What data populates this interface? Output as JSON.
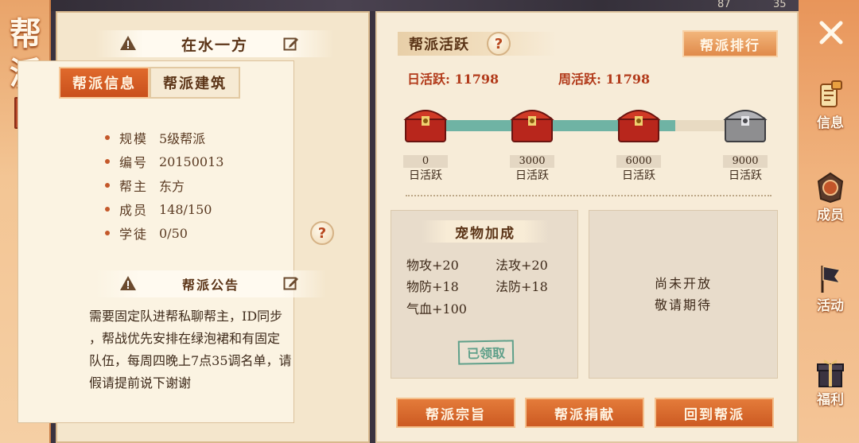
{
  "top_strip": {
    "left_number": "87",
    "right_number": "35"
  },
  "banner": {
    "title": "帮派"
  },
  "guild_name": "在水一方",
  "tabs": [
    {
      "label": "帮派信息",
      "active": true
    },
    {
      "label": "帮派建筑",
      "active": false
    }
  ],
  "info": [
    {
      "key": "规模",
      "value": "5级帮派"
    },
    {
      "key": "编号",
      "value": "20150013"
    },
    {
      "key": "帮主",
      "value": "东方"
    },
    {
      "key": "成员",
      "value": "148/150"
    },
    {
      "key": "学徒",
      "value": "0/50"
    }
  ],
  "help_glyph": "?",
  "notice": {
    "title": "帮派公告",
    "lines": [
      "需要固定队进帮私聊帮主，ID同步",
      "，帮战优先安排在绿泡裙和有固定",
      "队伍，每周四晚上7点35调名单，请",
      "假请提前说下谢谢"
    ]
  },
  "activity": {
    "title": "帮派活跃",
    "rank_button": "帮派排行",
    "daily_label": "日活跃: 11798",
    "weekly_label": "周活跃: 11798",
    "progress_fraction": 0.78,
    "chests": [
      {
        "value": "0",
        "label": "日活跃",
        "state": "red"
      },
      {
        "value": "3000",
        "label": "日活跃",
        "state": "red"
      },
      {
        "value": "6000",
        "label": "日活跃",
        "state": "red"
      },
      {
        "value": "9000",
        "label": "日活跃",
        "state": "silver"
      }
    ]
  },
  "pet_bonus": {
    "title": "宠物加成",
    "stats": [
      "物攻+20",
      "法攻+20",
      "物防+18",
      "法防+18",
      "气血+100"
    ],
    "claimed": "已领取"
  },
  "coming_soon": [
    "尚未开放",
    "敬请期待"
  ],
  "bottom_buttons": [
    "帮派宗旨",
    "帮派捐献",
    "回到帮派"
  ],
  "sidebar": [
    {
      "label": "信息",
      "icon": "scroll-icon"
    },
    {
      "label": "成员",
      "icon": "guild-emblem-icon"
    },
    {
      "label": "活动",
      "icon": "flag-icon"
    },
    {
      "label": "福利",
      "icon": "gift-icon"
    }
  ],
  "colors": {
    "accent": "#cc5a22",
    "teal": "#6fb3a4",
    "panel": "#f7ecd8"
  }
}
